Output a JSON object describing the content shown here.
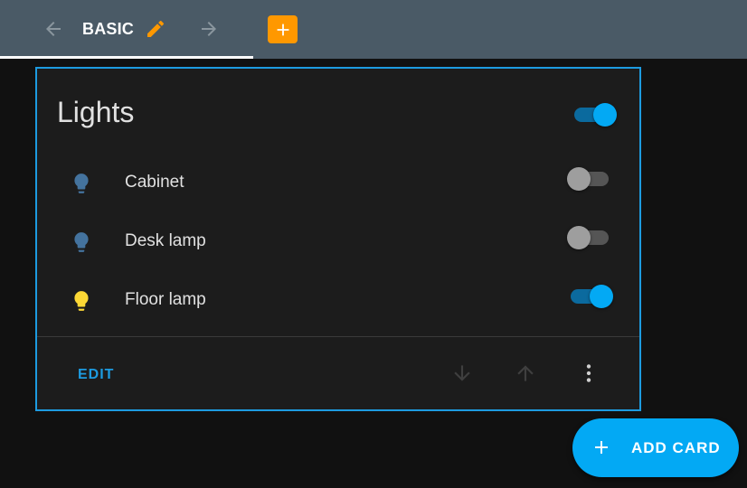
{
  "header": {
    "tab_label": "BASIC",
    "icons": {
      "back": "arrow-left-icon",
      "edit": "pencil-icon",
      "forward": "arrow-right-icon",
      "add_view": "plus-icon"
    },
    "colors": {
      "background": "#4a5a66",
      "edit_icon": "#ff9800",
      "add_view_button": "#ff9800"
    }
  },
  "card": {
    "title": "Lights",
    "master_on": true,
    "entities": [
      {
        "name": "Cabinet",
        "on": false,
        "icon": "lightbulb-icon",
        "icon_color": "#44739e"
      },
      {
        "name": "Desk lamp",
        "on": false,
        "icon": "lightbulb-icon",
        "icon_color": "#44739e"
      },
      {
        "name": "Floor lamp",
        "on": true,
        "icon": "lightbulb-icon",
        "icon_color": "#fdd835"
      }
    ],
    "actions": {
      "edit_label": "EDIT",
      "move_down_icon": "arrow-down-icon",
      "move_up_icon": "arrow-up-icon",
      "more_icon": "dots-vertical-icon"
    },
    "colors": {
      "border": "#1d9be0",
      "accent": "#03a9f4"
    }
  },
  "fab": {
    "label": "ADD CARD",
    "icon": "plus-icon",
    "color": "#03a9f4"
  }
}
